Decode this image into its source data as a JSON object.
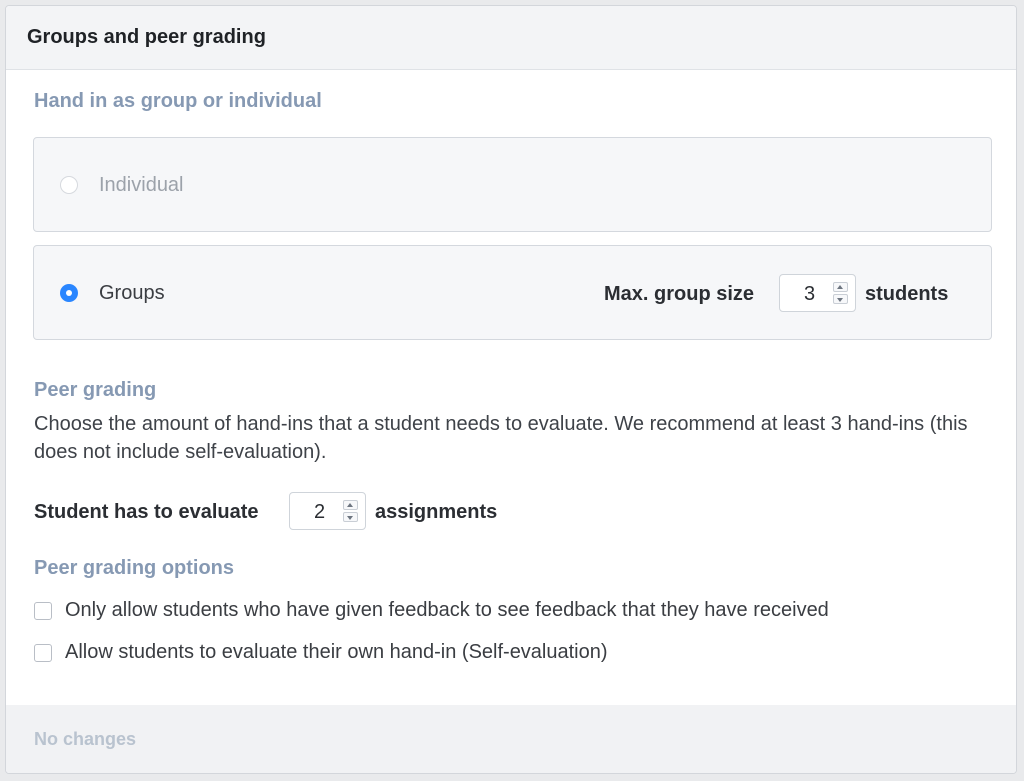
{
  "panel": {
    "title": "Groups and peer grading"
  },
  "hand_in": {
    "section_title": "Hand in as group or individual",
    "options": [
      {
        "label": "Individual",
        "selected": false,
        "disabled": true
      },
      {
        "label": "Groups",
        "selected": true,
        "disabled": false
      }
    ],
    "max_group_size_label": "Max. group size",
    "max_group_size_value": "3",
    "max_group_size_unit": "students"
  },
  "peer_grading": {
    "section_title": "Peer grading",
    "description": "Choose the amount of hand-ins that a student needs to evaluate. We recommend at least 3 hand-ins (this does not include self-evaluation).",
    "evaluate_label": "Student has to evaluate",
    "evaluate_value": "2",
    "evaluate_unit": "assignments"
  },
  "peer_grading_options": {
    "section_title": "Peer grading options",
    "items": [
      {
        "label": "Only allow students who have given feedback to see feedback that they have received",
        "checked": false
      },
      {
        "label": "Allow students to evaluate their own hand-in (Self-evaluation)",
        "checked": false
      }
    ]
  },
  "footer": {
    "status": "No changes"
  },
  "colors": {
    "accent": "#2a86ff",
    "section_title": "#8699b3",
    "footer_text": "#b9c3cf"
  }
}
